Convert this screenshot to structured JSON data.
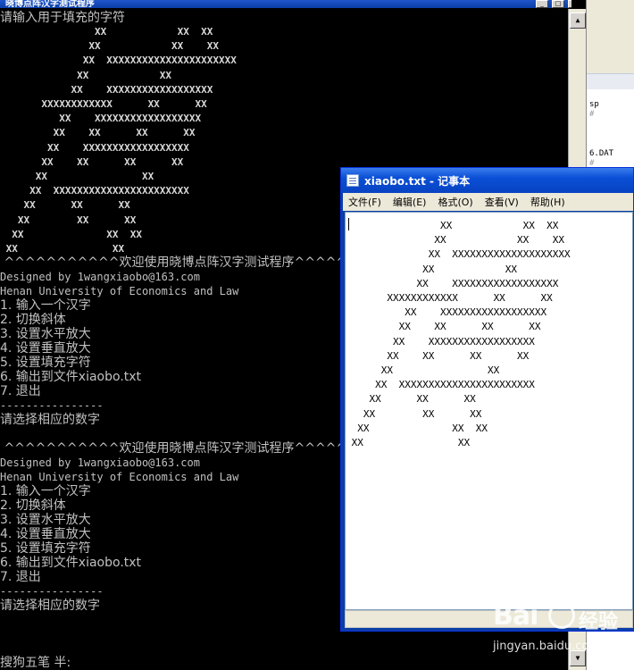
{
  "console": {
    "title": "晓博点阵汉字测试程序",
    "controls": [
      "_",
      "□",
      "×"
    ],
    "prompt_fill": "请输入用于填充的字符",
    "art": [
      "                XX            XX  XX",
      "               XX            XX    XX",
      "              XX  XXXXXXXXXXXXXXXXXXXXXX",
      "             XX            XX",
      "            XX    XXXXXXXXXXXXXXXXXX",
      "       XXXXXXXXXXXX      XX      XX",
      "          XX    XXXXXXXXXXXXXXXXXX",
      "         XX    XX      XX      XX",
      "        XX    XXXXXXXXXXXXXXXXXX",
      "       XX    XX      XX      XX",
      "      XX                XX",
      "     XX  XXXXXXXXXXXXXXXXXXXXXXX",
      "    XX      XX      XX",
      "   XX        XX      XX",
      "  XX              XX  XX",
      " XX                XX"
    ],
    "menu_blocks": [
      {
        "banner": " ^^^^^^^^^^^欢迎使用晓博点阵汉字测试程序^^^^^^^^^^^",
        "designed": "Designed by 1wangxiaobo@163.com",
        "school": "Henan University of Economics and Law",
        "items": [
          "1. 输入一个汉字",
          "2. 切换斜体",
          "3. 设置水平放大",
          "4. 设置垂直放大",
          "5. 设置填充字符",
          "6. 输出到文件xiaobo.txt",
          "7. 退出"
        ],
        "divider": "----------------",
        "prompt": "请选择相应的数字"
      },
      {
        "banner": " ^^^^^^^^^^^欢迎使用晓博点阵汉字测试程序^^^^^^^^^^^",
        "designed": "Designed by 1wangxiaobo@163.com",
        "school": "Henan University of Economics and Law",
        "items": [
          "1. 输入一个汉字",
          "2. 切换斜体",
          "3. 设置水平放大",
          "4. 设置垂直放大",
          "5. 设置填充字符",
          "6. 输出到文件xiaobo.txt",
          "7. 退出"
        ],
        "divider": "----------------",
        "prompt": "请选择相应的数字"
      }
    ],
    "ime_status": "搜狗五笔 半:"
  },
  "background_window": {
    "texts": [
      "sp",
      "#",
      "6.DAT",
      "#"
    ]
  },
  "notepad": {
    "title": "xiaobo.txt - 记事本",
    "menus": [
      "文件(F)",
      "编辑(E)",
      "格式(O)",
      "查看(V)",
      "帮助(H)"
    ],
    "lines": [
      "                XX            XX  XX",
      "               XX            XX    XX",
      "              XX  XXXXXXXXXXXXXXXXXXXX",
      "             XX            XX",
      "            XX    XXXXXXXXXXXXXXXXXX",
      "       XXXXXXXXXXXX      XX      XX",
      "          XX    XXXXXXXXXXXXXXXXXX",
      "         XX    XX      XX      XX",
      "        XX    XXXXXXXXXXXXXXXXXX",
      "       XX    XX      XX      XX",
      "      XX                XX",
      "     XX  XXXXXXXXXXXXXXXXXXXXXXX",
      "    XX      XX      XX",
      "   XX        XX      XX",
      "  XX              XX  XX",
      " XX                XX"
    ]
  },
  "watermark": {
    "logo": "Bai",
    "logo2": "经验",
    "url": "jingyan.baidu.com"
  }
}
